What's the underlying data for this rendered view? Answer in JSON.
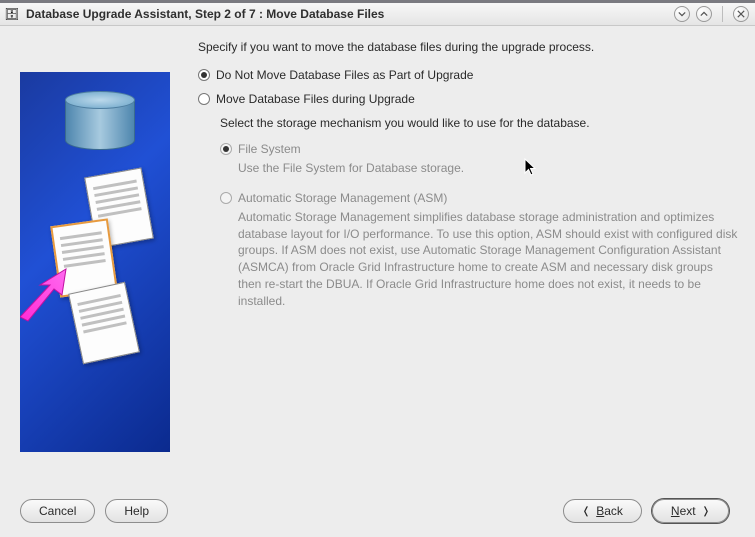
{
  "titlebar": {
    "app_icon": "🗄",
    "title": "Database Upgrade Assistant, Step 2 of 7 : Move Database Files"
  },
  "instruction": "Specify if you want to move the database files during the upgrade process.",
  "options": {
    "do_not_move": {
      "label": "Do Not Move Database Files as Part of Upgrade",
      "selected": true
    },
    "move": {
      "label": "Move Database Files during Upgrade",
      "selected": false
    }
  },
  "storage_instruction": "Select the storage mechanism you would like to use for the database.",
  "storage": {
    "file_system": {
      "label": "File System",
      "desc": "Use the File System for Database storage.",
      "selected": true
    },
    "asm": {
      "label": "Automatic Storage Management (ASM)",
      "desc": "Automatic Storage Management simplifies database storage administration and optimizes database layout for I/O performance. To use this option, ASM should exist with configured disk groups. If ASM does not exist, use Automatic Storage Management Configuration Assistant (ASMCA) from Oracle Grid Infrastructure home to create ASM and necessary disk groups then re-start the DBUA. If Oracle Grid Infrastructure home does not exist, it needs to be installed.",
      "selected": false
    }
  },
  "buttons": {
    "cancel": "Cancel",
    "help": "Help",
    "back": "Back",
    "next": "Next"
  }
}
